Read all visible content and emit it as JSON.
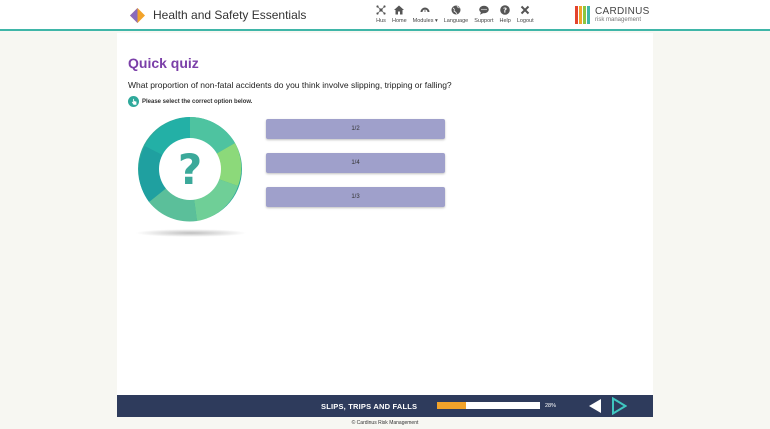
{
  "header": {
    "title": "Health and Safety Essentials",
    "nav": [
      {
        "label": "Hus",
        "icon": "hub-icon"
      },
      {
        "label": "Home",
        "icon": "home-icon"
      },
      {
        "label": "Modules ▾",
        "icon": "modules-icon"
      },
      {
        "label": "Language",
        "icon": "globe-icon"
      },
      {
        "label": "Support",
        "icon": "chat-icon"
      },
      {
        "label": "Help",
        "icon": "help-icon"
      },
      {
        "label": "Logout",
        "icon": "close-icon"
      }
    ],
    "brand": {
      "name": "CARDINUS",
      "sub": "risk management",
      "bar_colors": [
        "#e4432d",
        "#f2a32a",
        "#8cc63f",
        "#3fb6a8"
      ]
    }
  },
  "quiz": {
    "title": "Quick quiz",
    "question": "What proportion of non-fatal accidents do you think involve slipping, tripping or falling?",
    "instruction": "Please select the correct option below.",
    "options": [
      "1/2",
      "1/4",
      "1/3"
    ]
  },
  "footer": {
    "section": "SLIPS, TRIPS AND FALLS",
    "progress": 28,
    "progress_label": "28%",
    "copyright": "© Cardinus Risk Management"
  },
  "colors": {
    "accent": "#3fb6a8",
    "title": "#7b3fa8",
    "option_bg": "#9fa0cb",
    "footer_bg": "#2e3b5c",
    "progress": "#f2a32a"
  }
}
